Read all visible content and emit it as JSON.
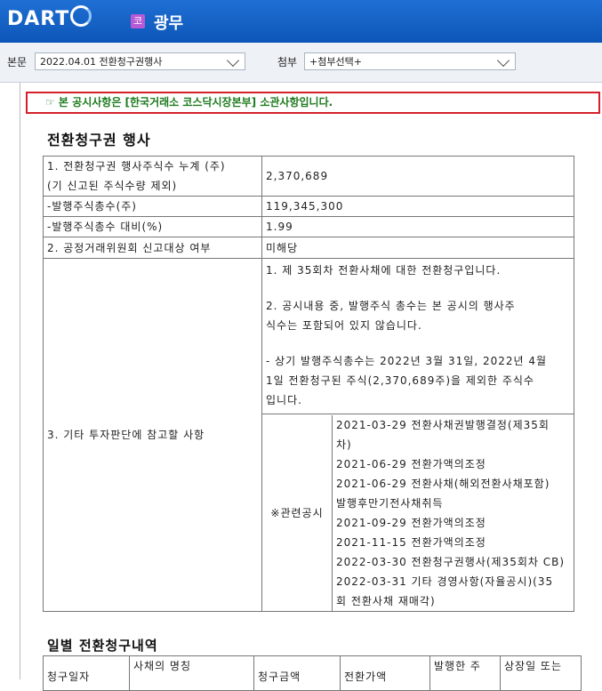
{
  "header": {
    "logo_text": "DART",
    "corp_badge": "코",
    "corp_name": "광무",
    "colors": {
      "bar": "#1462c9",
      "notice_border": "#d4202a",
      "notice_text": "#1e7b1e"
    }
  },
  "selectors": {
    "main_label": "본문",
    "main_value": "2022.04.01  전환청구권행사",
    "attach_label": "첨부",
    "attach_value": "+첨부선택+"
  },
  "notice": "☞ 본 공시사항은 [한국거래소 코스닥시장본부] 소관사항입니다.",
  "title": "전환청구권 행사",
  "rows": [
    {
      "label_lines": [
        "1. 전환청구권 행사주식수 누계 (주)",
        "(기 신고된 주식수량 제외)"
      ],
      "value": "2,370,689"
    },
    {
      "label_lines": [
        "-발행주식총수(주)"
      ],
      "value": "119,345,300"
    },
    {
      "label_lines": [
        "-발행주식총수 대비(%)"
      ],
      "value": "1.99"
    },
    {
      "label_lines": [
        "2. 공정거래위원회 신고대상 여부"
      ],
      "value": "미해당"
    }
  ],
  "row3": {
    "label": "3. 기타 투자판단에 참고할 사항",
    "paragraphs": [
      [
        "1. 제 35회차 전환사채에 대한 전환청구입니다."
      ],
      [
        "2. 공시내용 중, 발행주식 총수는 본 공시의 행사주",
        "식수는 포함되어 있지 않습니다."
      ],
      [
        "- 상기 발행주식총수는 2022년 3월 31일, 2022년 4월",
        "1일 전환청구된 주식(2,370,689주)을 제외한 주식수",
        "입니다."
      ]
    ],
    "related_label": "※관련공시",
    "related": [
      [
        "2021-03-29 전환사채권발행결정(제35회",
        "차)"
      ],
      [
        "2021-06-29 전환가액의조정"
      ],
      [
        "2021-06-29 전환사채(해외전환사채포함)",
        "발행후만기전사채취득"
      ],
      [
        "2021-09-29 전환가액의조정"
      ],
      [
        "2021-11-15 전환가액의조정"
      ],
      [
        "2022-03-30 전환청구권행사(제35회차 CB)"
      ],
      [
        "2022-03-31 기타 경영사항(자율공시)(35",
        "회 전환사채 재매각)"
      ]
    ]
  },
  "daily": {
    "title": "일별 전환청구내역",
    "headers": [
      "청구일자",
      "사채의 명칭",
      "청구금액",
      "전환가액",
      "발행한 주",
      "상장일 또는"
    ]
  }
}
